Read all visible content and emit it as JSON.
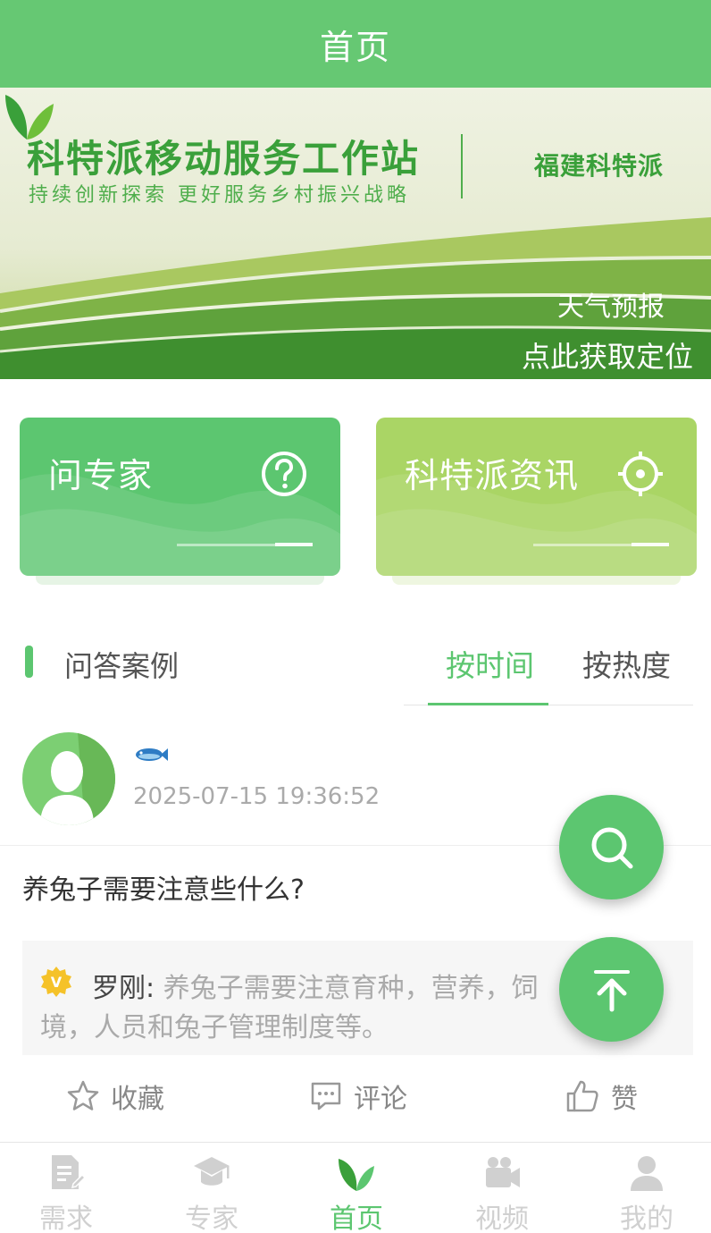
{
  "header": {
    "title": "首页"
  },
  "banner": {
    "title": "科特派移动服务工作站",
    "subtitle": "持续创新探索 更好服务乡村振兴战略",
    "brand_name": "福建科特派",
    "weather_label": "天气预报",
    "location_label": "点此获取定位"
  },
  "cards": {
    "expert_label": "问专家",
    "news_label": "科特派资讯"
  },
  "section": {
    "title": "问答案例",
    "tabs": [
      {
        "label": "按时间",
        "active": true
      },
      {
        "label": "按热度",
        "active": false
      }
    ]
  },
  "post": {
    "timestamp": "2025-07-15 19:36:52",
    "question": "养兔子需要注意些什么?",
    "answer_author": "罗刚:",
    "answer_line1": "养兔子需要注意育种，营养，饲",
    "answer_line2": "境，人员和兔子管理制度等。",
    "actions": {
      "collect": "收藏",
      "comment": "评论",
      "like": "赞"
    }
  },
  "bottom_nav": {
    "items": [
      {
        "label": "需求",
        "icon": "document-edit-icon"
      },
      {
        "label": "专家",
        "icon": "graduation-cap-icon"
      },
      {
        "label": "首页",
        "icon": "leaf-icon",
        "active": true
      },
      {
        "label": "视频",
        "icon": "video-camera-icon"
      },
      {
        "label": "我的",
        "icon": "user-icon"
      }
    ]
  },
  "colors": {
    "primary": "#66c873",
    "accent_green": "#5cc670",
    "light_green": "#aad565",
    "nav_inactive": "#d0d0d0",
    "muted_text": "#aaaaaa"
  }
}
